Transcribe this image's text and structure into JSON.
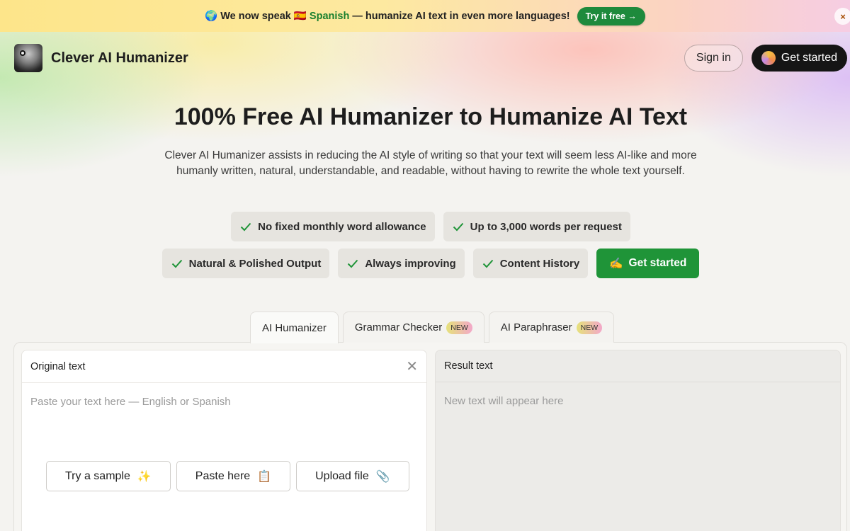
{
  "announcement": {
    "globe": "🌍",
    "prefix": "We now speak",
    "flag": "🇪🇸",
    "language": "Spanish",
    "suffix": "— humanize AI text in even more languages!",
    "cta": "Try it free →",
    "close": "×"
  },
  "header": {
    "brand": "Clever AI Humanizer",
    "sign_in": "Sign in",
    "get_started": "Get started"
  },
  "hero": {
    "title": "100% Free AI Humanizer to Humanize AI Text",
    "description": "Clever AI Humanizer assists in reducing the AI style of writing so that your text will seem less AI-like and more humanly written, natural, understandable, and readable, without having to rewrite the whole text yourself."
  },
  "features": {
    "row1": [
      "No fixed monthly word allowance",
      "Up to 3,000 words per request"
    ],
    "row2": [
      "Natural & Polished Output",
      "Always improving",
      "Content History"
    ],
    "cta_icon": "✍️",
    "cta": "Get started"
  },
  "tabs": [
    {
      "label": "AI Humanizer",
      "badge": ""
    },
    {
      "label": "Grammar Checker",
      "badge": "NEW"
    },
    {
      "label": "AI Paraphraser",
      "badge": "NEW"
    }
  ],
  "editor": {
    "original_title": "Original text",
    "original_placeholder": "Paste your text here — English or Spanish",
    "result_title": "Result text",
    "result_placeholder": "New text will appear here",
    "buttons": {
      "sample": "Try a sample",
      "sample_icon": "✨",
      "paste": "Paste here",
      "paste_icon": "📋",
      "upload": "Upload file",
      "upload_icon": "📎"
    }
  },
  "colors": {
    "accent_green": "#1f9438",
    "dark_button": "#151515"
  }
}
